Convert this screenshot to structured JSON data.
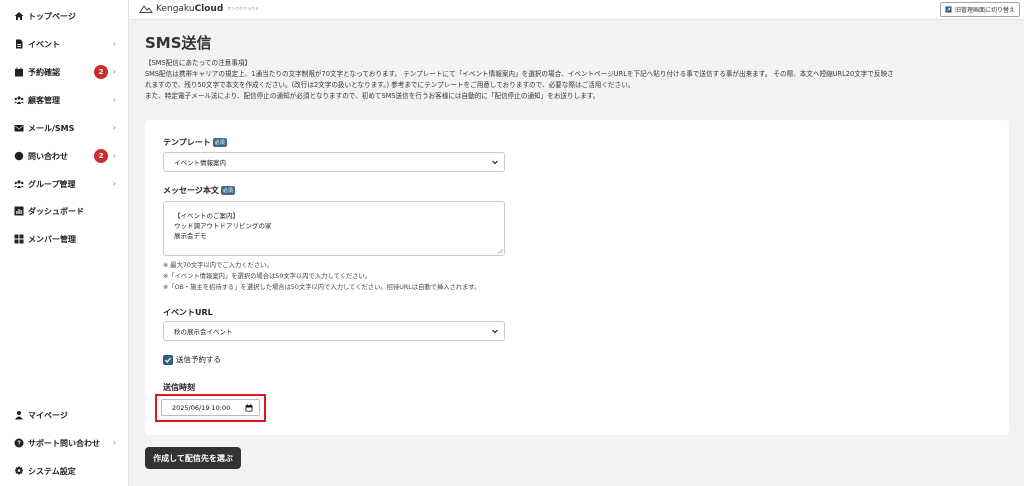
{
  "sidebar": {
    "items": [
      {
        "label": "トップページ",
        "icon": "home-icon"
      },
      {
        "label": "イベント",
        "icon": "document-icon",
        "chevron": "›"
      },
      {
        "label": "予約確認",
        "icon": "calendar-icon",
        "badge": "2",
        "chevron": "›"
      },
      {
        "label": "顧客管理",
        "icon": "users-icon",
        "chevron": "›"
      },
      {
        "label": "メール/SMS",
        "icon": "mail-icon",
        "chevron": "›"
      },
      {
        "label": "問い合わせ",
        "icon": "chat-icon",
        "badge": "2",
        "chevron": "›"
      },
      {
        "label": "グループ管理",
        "icon": "group-icon",
        "chevron": "›"
      },
      {
        "label": "ダッシュボード",
        "icon": "chart-icon"
      },
      {
        "label": "メンバー管理",
        "icon": "grid-icon"
      }
    ],
    "bottom": [
      {
        "label": "マイページ",
        "icon": "person-icon"
      },
      {
        "label": "サポート問い合わせ",
        "icon": "question-icon",
        "chevron": "›"
      },
      {
        "label": "システム設定",
        "icon": "gear-icon"
      }
    ]
  },
  "topbar": {
    "logo_prefix": "Kengaku",
    "logo_bold": "Cloud",
    "logo_sub": "ケンガククラウド",
    "switch_label": "旧管理画面に切り替え"
  },
  "page": {
    "title": "SMS送信",
    "notice": [
      "【SMS配信にあたっての注意事項】",
      "SMS配信は携帯キャリアの規定上、1通当たりの文字制限が70文字となっております。 テンプレートにて「イベント情報案内」を選択の場合、イベントページURLを下記へ貼り付ける事で送信する事が出来ます。 その際、本文へ短縮URL20文字で反映さ",
      "れますので、残り50文字で本文を作成ください。(改行は2文字の扱いとなります。) 参考までにテンプレートをご用意しておりますので、必要な際はご活用ください。",
      "また、特定電子メール法により、配信停止の通知が必須となりますので、初めてSMS送信を行うお客様には自動的に「配信停止の通知」をお送りします。"
    ]
  },
  "form": {
    "required_badge": "必須",
    "template_label": "テンプレート",
    "template_value": "イベント情報案内",
    "message_label": "メッセージ本文",
    "message_lines": [
      "【イベントのご案内】",
      "ウッド調アウトドアリビングの家",
      "展示会デモ"
    ],
    "notes": [
      "※ 最大70文字以内でご入力ください。",
      "※「イベント情報案内」を選択の場合は50文字以内で入力してください。",
      "※「OB・施主を招待する」を選択した場合は50文字以内で入力してください。招待URLは自動で挿入されます。"
    ],
    "event_url_label": "イベントURL",
    "event_url_value": "秋の展示会イベント",
    "schedule_checkbox_label": "送信予約する",
    "send_time_label": "送信時刻",
    "send_time_value": "2025/06/19 10:00",
    "submit_label": "作成して配信先を選ぶ"
  },
  "colors": {
    "badge": "#c8302c",
    "accent": "#2f5f7e",
    "highlight": "#e0171b",
    "submit": "#333333"
  }
}
